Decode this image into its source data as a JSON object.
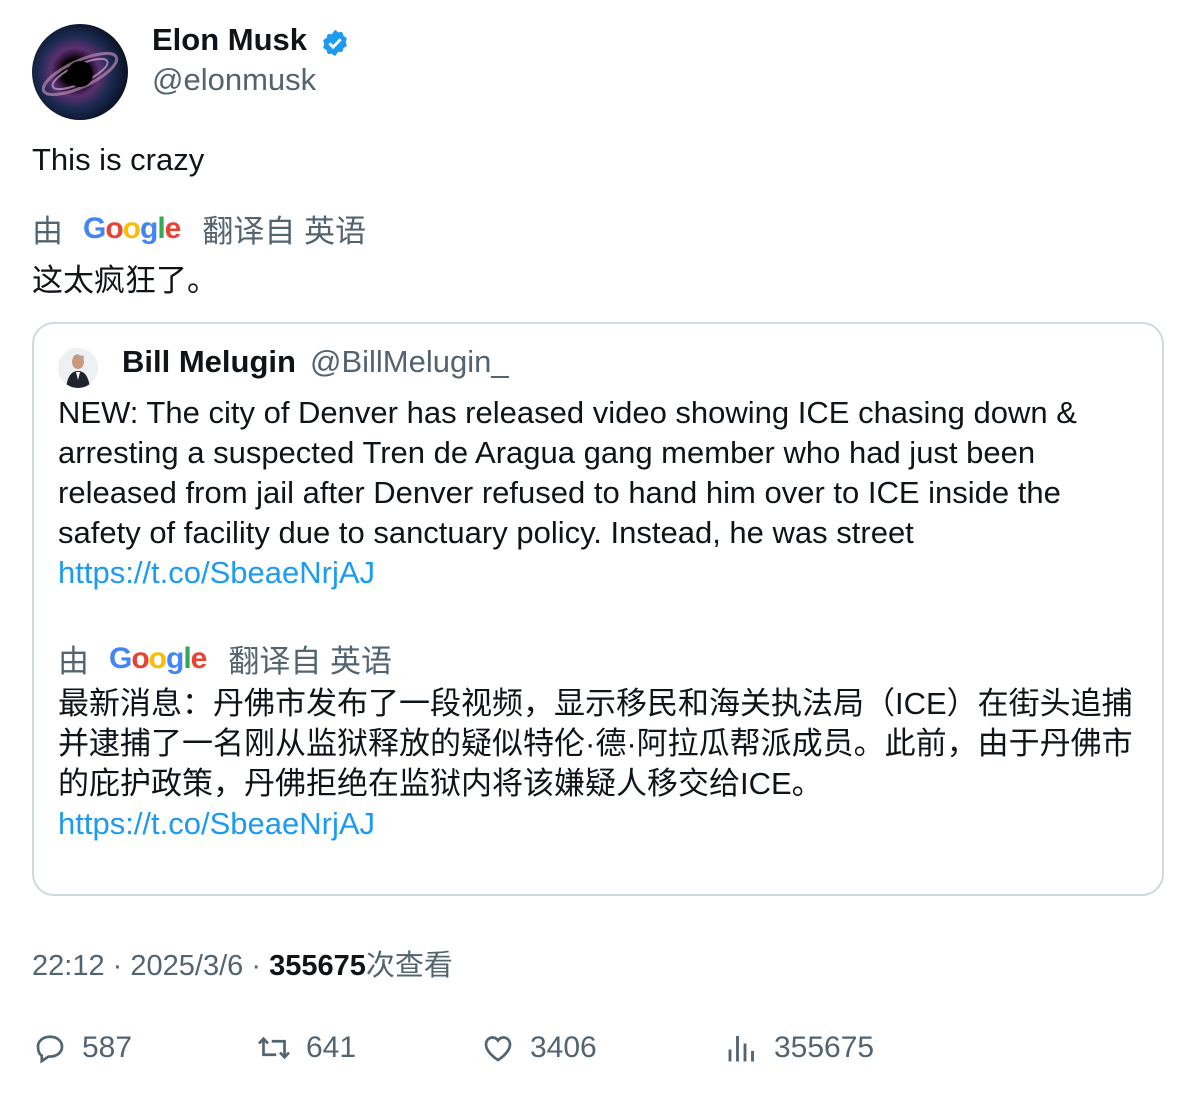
{
  "author": {
    "name": "Elon Musk",
    "handle": "@elonmusk",
    "verified_color": "#1d9bf0"
  },
  "tweet": {
    "text": "This is crazy",
    "translation_text": "这太疯狂了。"
  },
  "translation": {
    "prefix": "由",
    "brand": "Google",
    "suffix": "翻译自 英语"
  },
  "quoted": {
    "name": "Bill Melugin",
    "handle": "@BillMelugin_",
    "text": "NEW: The city of Denver has released video showing ICE chasing down & arresting a suspected Tren de Aragua gang member who had just been released from jail after Denver refused to hand him over to ICE inside the safety of facility due to sanctuary policy. Instead, he was street",
    "link": "https://t.co/SbeaeNrjAJ",
    "translation_text": "最新消息：丹佛市发布了一段视频，显示移民和海关执法局（ICE）在街头追捕并逮捕了一名刚从监狱释放的疑似特伦·德·阿拉瓜帮派成员。此前，由于丹佛市的庇护政策，丹佛拒绝在监狱内将该嫌疑人移交给ICE。",
    "translation_link": "https://t.co/SbeaeNrjAJ"
  },
  "meta": {
    "time": "22:12",
    "sep": "·",
    "date": "2025/3/6",
    "views": "355675",
    "views_label": "次查看"
  },
  "actions": {
    "replies": "587",
    "reposts": "641",
    "likes": "3406",
    "views": "355675"
  },
  "colors": {
    "link": "#1d9bf0",
    "muted": "#536471",
    "text": "#0f1419",
    "border": "#cfd9de"
  }
}
